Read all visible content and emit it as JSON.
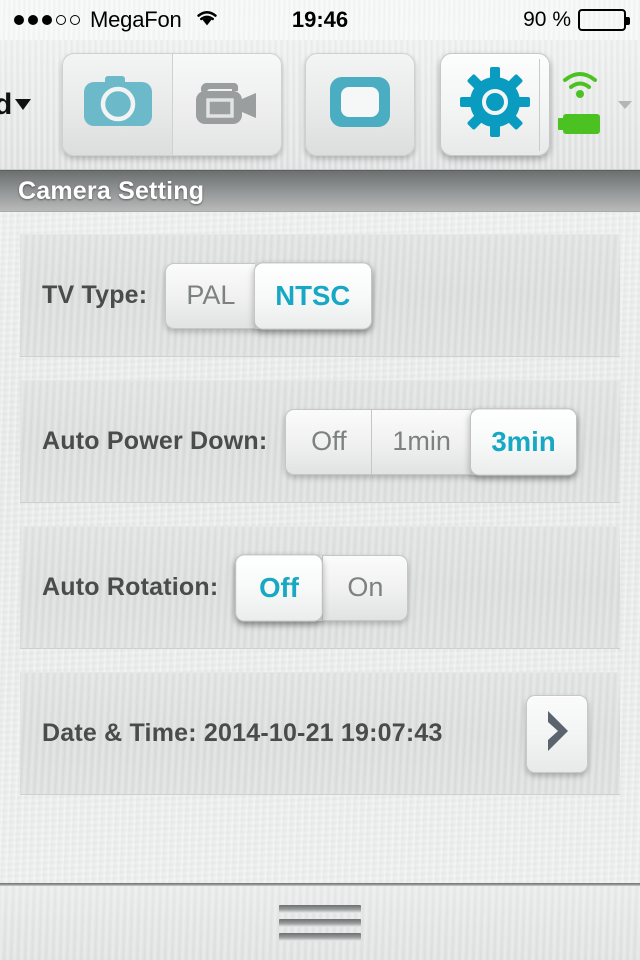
{
  "status_bar": {
    "signal_dots_total": 5,
    "signal_dots_filled": 3,
    "carrier": "MegaFon",
    "wifi_icon": "wifi-icon",
    "time": "19:46",
    "battery_percent": "90 %",
    "battery_level": 90
  },
  "toolbar": {
    "left_label": "d",
    "left_caret_icon": "caret-down-icon",
    "items": [
      {
        "name": "photo-mode",
        "icon": "camera-icon",
        "active": true
      },
      {
        "name": "video-mode",
        "icon": "video-camera-icon",
        "active": false
      },
      {
        "name": "playback-mode",
        "icon": "frame-icon",
        "active": false
      },
      {
        "name": "settings-mode",
        "icon": "gear-icon",
        "active": true
      }
    ],
    "status_icons": {
      "wifi": "wifi-signal-icon",
      "battery": "battery-icon",
      "caret": "caret-down-icon"
    }
  },
  "page": {
    "title": "Camera Setting"
  },
  "settings": [
    {
      "id": "tv-type",
      "label": "TV Type:",
      "control": "segmented",
      "options": [
        "PAL",
        "NTSC"
      ],
      "selected": "NTSC"
    },
    {
      "id": "auto-power-down",
      "label": "Auto Power Down:",
      "control": "segmented",
      "options": [
        "Off",
        "1min",
        "3min"
      ],
      "selected": "3min"
    },
    {
      "id": "auto-rotation",
      "label": "Auto Rotation:",
      "control": "segmented",
      "options": [
        "Off",
        "On"
      ],
      "selected": "Off"
    },
    {
      "id": "date-time",
      "label": "Date & Time: 2014-10-21 19:07:43",
      "control": "navigate",
      "chevron_icon": "chevron-right-icon"
    }
  ],
  "bottom_bar": {
    "menu_icon": "hamburger-menu-icon"
  },
  "colors": {
    "accent_teal": "#17a8c4",
    "icon_gray": "#9b9e9e",
    "label_gray": "#4b4b4b",
    "status_green": "#4cc222",
    "chevron_slate": "#5a636e",
    "title_gray": "#8e9191"
  }
}
